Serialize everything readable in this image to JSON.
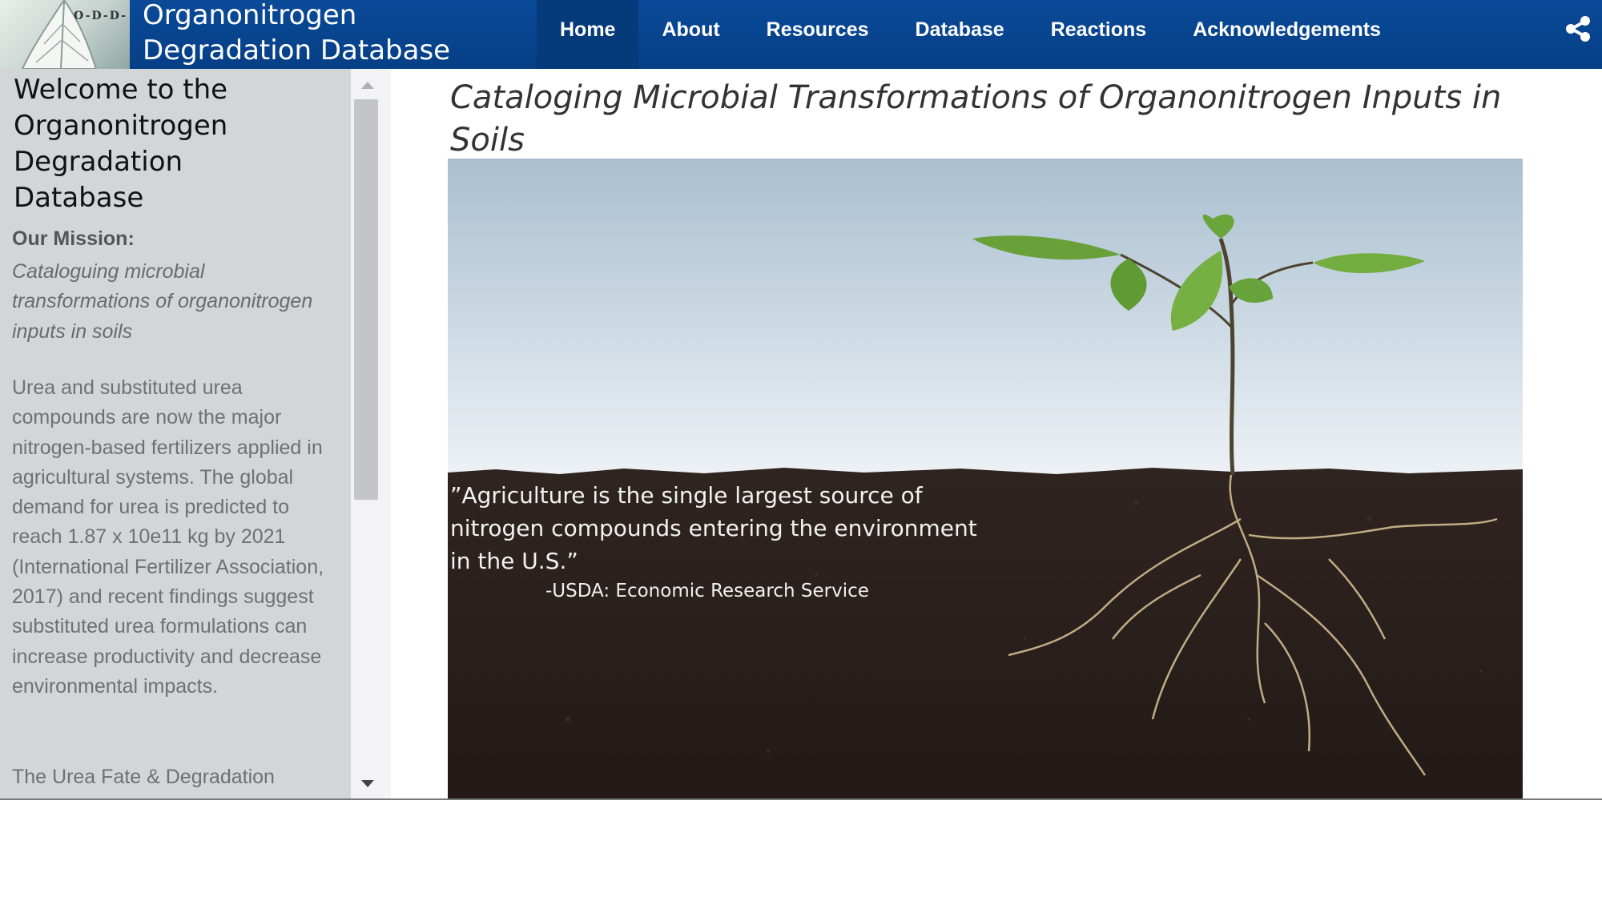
{
  "header": {
    "logo_text": "O-D-D-",
    "site_title": "Organonitrogen Degradation Database",
    "nav": [
      {
        "label": "Home",
        "active": true
      },
      {
        "label": "About"
      },
      {
        "label": "Resources"
      },
      {
        "label": "Database"
      },
      {
        "label": "Reactions"
      },
      {
        "label": "Acknowledgements"
      }
    ],
    "share_icon": "share-icon"
  },
  "sidebar": {
    "welcome": "Welcome to the Organonitrogen Degradation Database",
    "mission_title": "Our Mission:",
    "mission_text": "Cataloguing microbial transformations of organonitrogen inputs in soils",
    "body_text": "Urea and substituted urea compounds are now the major nitrogen-based fertilizers applied in agricultural systems. The global demand for urea is predicted to reach 1.87 x 10e11 kg by 2021 (International Fertilizer Association, 2017) and recent findings suggest substituted urea formulations can increase productivity and decrease environmental impacts.",
    "body_text_2": "The Urea Fate & Degradation"
  },
  "main": {
    "title": "Cataloging Microbial Transformations of Organonitrogen Inputs in Soils",
    "hero": {
      "quote": "”Agriculture is the single largest source of nitrogen compounds entering the environment in the U.S.”",
      "source": "-USDA: Economic Research Service"
    }
  },
  "colors": {
    "header_bg": "#0a4a98",
    "sidebar_bg": "#d3d6d7",
    "soil": "#2b211e",
    "sky_top": "#a9bfd0"
  }
}
